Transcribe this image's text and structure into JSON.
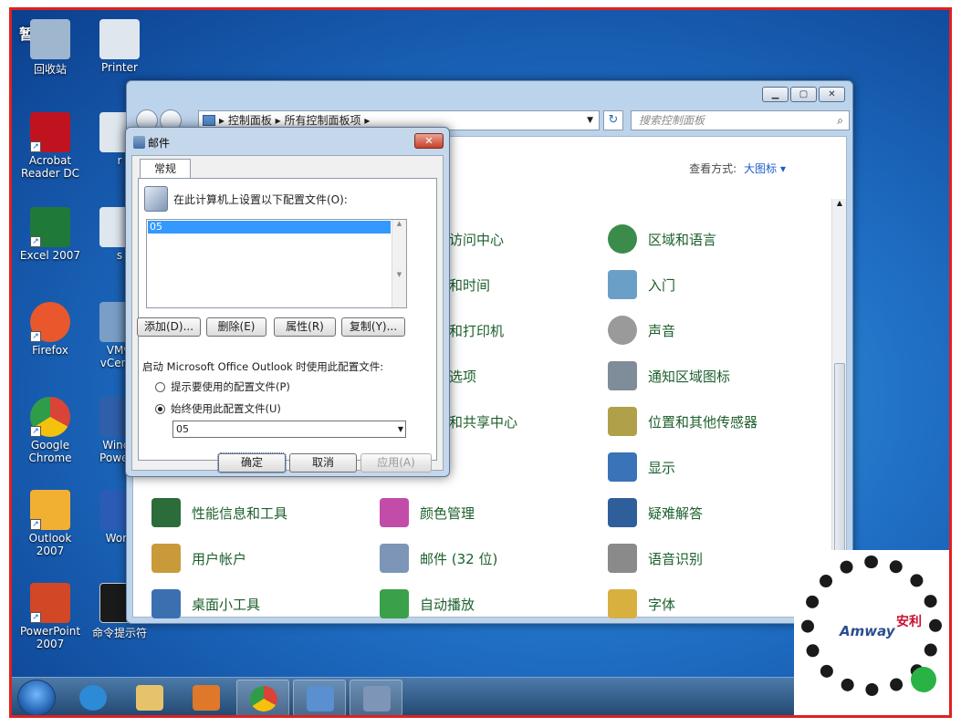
{
  "desktop": {
    "paused_label": "暂停",
    "icons": [
      {
        "label": "回收站",
        "color": "#9fb6cf"
      },
      {
        "label": "Printer",
        "color": "#dfe6ee"
      },
      {
        "label": "Acrobat\nReader DC",
        "color": "#c1121f"
      },
      {
        "label": "r",
        "color": "#dfe6ee"
      },
      {
        "label": "Excel 2007",
        "color": "#1f7a3a"
      },
      {
        "label": "s",
        "color": "#dfe6ee"
      },
      {
        "label": "Firefox",
        "color": "#e8582c"
      },
      {
        "label": "VMw\nvCente",
        "color": "#7a9fc7"
      },
      {
        "label": "Google\nChrome",
        "color": "#2f9c4a"
      },
      {
        "label": "Windo\nPowerS",
        "color": "#2e5fa8"
      },
      {
        "label": "Outlook\n2007",
        "color": "#f2b033"
      },
      {
        "label": "Word",
        "color": "#2a5bb5"
      },
      {
        "label": "PowerPoint\n2007",
        "color": "#d24726"
      },
      {
        "label": "命令提示符",
        "color": "#1a1a1a"
      }
    ]
  },
  "control_panel": {
    "address": {
      "root": "控制面板",
      "current": "所有控制面板项"
    },
    "search_placeholder": "搜索控制面板",
    "view_by_label": "查看方式:",
    "view_by_value": "大图标 ▾",
    "items": [
      {
        "label": "访问中心",
        "color": "#5a7fb0"
      },
      {
        "label": "区域和语言",
        "color": "#3b8c4a"
      },
      {
        "label": "和时间",
        "color": "#6a6a6a"
      },
      {
        "label": "入门",
        "color": "#6aa0c8"
      },
      {
        "label": "和打印机",
        "color": "#6a6a6a"
      },
      {
        "label": "声音",
        "color": "#9a9a9a"
      },
      {
        "label": "选项",
        "color": "#6a6a6a"
      },
      {
        "label": "通知区域图标",
        "color": "#7f8c99"
      },
      {
        "label": "和共享中心",
        "color": "#6a6a6a"
      },
      {
        "label": "位置和其他传感器",
        "color": "#b0a04a"
      },
      {
        "label": "显示",
        "color": "#3a73b8"
      },
      {
        "label": "性能信息和工具",
        "color": "#2c6b3a"
      },
      {
        "label": "颜色管理",
        "color": "#c24da8"
      },
      {
        "label": "疑难解答",
        "color": "#2f5f9a"
      },
      {
        "label": "用户帐户",
        "color": "#c89a3a"
      },
      {
        "label": "邮件 (32 位)",
        "color": "#7d95b6"
      },
      {
        "label": "语音识别",
        "color": "#8a8a8a"
      },
      {
        "label": "桌面小工具",
        "color": "#3a6fb0"
      },
      {
        "label": "自动播放",
        "color": "#3aa04a"
      },
      {
        "label": "字体",
        "color": "#d8b040"
      }
    ]
  },
  "mail_dialog": {
    "title": "邮件",
    "close_label": "✕",
    "tab": "常规",
    "header": "在此计算机上设置以下配置文件(O):",
    "profiles": [
      "05"
    ],
    "buttons": {
      "add": "添加(D)...",
      "remove": "删除(E)",
      "properties": "属性(R)",
      "copy": "复制(Y)..."
    },
    "startup_label": "启动 Microsoft Office Outlook 时使用此配置文件:",
    "radio_prompt": "提示要使用的配置文件(P)",
    "radio_always": "始终使用此配置文件(U)",
    "selected_profile": "05",
    "ok": "确定",
    "cancel": "取消",
    "apply": "应用(A)"
  },
  "taskbar": {
    "items": [
      {
        "name": "internet-explorer",
        "color": "#2d8ad6",
        "open": false
      },
      {
        "name": "file-explorer",
        "color": "#e6c36a",
        "open": false
      },
      {
        "name": "media-player",
        "color": "#e0782a",
        "open": false
      },
      {
        "name": "chrome",
        "color": "#d94436",
        "open": true
      },
      {
        "name": "control-panel",
        "color": "#5a8fd0",
        "open": true
      },
      {
        "name": "mail",
        "color": "#7d95b6",
        "open": true
      }
    ]
  },
  "watermark": {
    "brand": "Amway",
    "sub": "安利"
  }
}
